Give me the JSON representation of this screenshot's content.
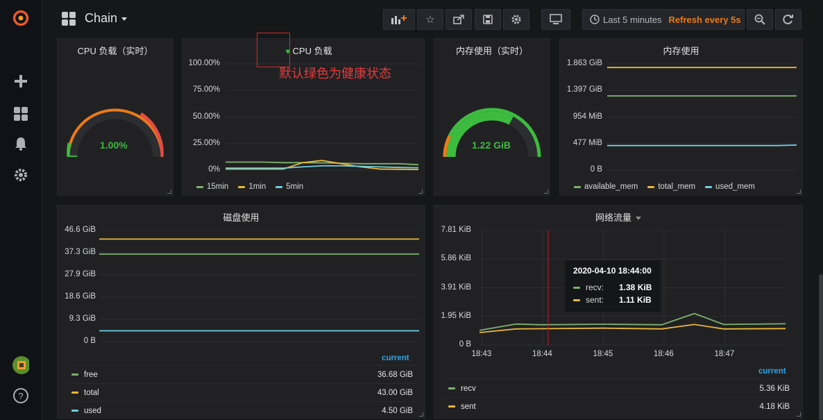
{
  "navbar": {
    "dashboard_title": "Chain",
    "time_range": "Last 5 minutes",
    "refresh": "Refresh every 5s"
  },
  "panels": {
    "cpu_gauge": {
      "title": "CPU 负载（实时）",
      "value": "1.00%",
      "value_number": 1.0,
      "max": 100
    },
    "cpu_graph": {
      "title": "CPU 负载",
      "health_icon": "heart-icon",
      "health_color": "#3dbb3f",
      "y_ticks": [
        "100.00%",
        "75.00%",
        "50.00%",
        "25.00%",
        "0%"
      ],
      "legend": [
        {
          "name": "15min",
          "color": "#7eb26d"
        },
        {
          "name": "1min",
          "color": "#eab839"
        },
        {
          "name": "5min",
          "color": "#6ed0e0"
        }
      ]
    },
    "mem_gauge": {
      "title": "内存使用（实时）",
      "value": "1.22 GiB",
      "value_number": 1.22,
      "max": 1.863
    },
    "mem_graph": {
      "title": "内存使用",
      "y_ticks": [
        "1.863 GiB",
        "1.397 GiB",
        "954 MiB",
        "477 MiB",
        "0 B"
      ],
      "legend": [
        {
          "name": "available_mem",
          "color": "#7eb26d"
        },
        {
          "name": "total_mem",
          "color": "#eab839"
        },
        {
          "name": "used_mem",
          "color": "#6ed0e0"
        }
      ]
    },
    "disk": {
      "title": "磁盘使用",
      "y_ticks": [
        "46.6 GiB",
        "37.3 GiB",
        "27.9 GiB",
        "18.6 GiB",
        "9.3 GiB",
        "0 B"
      ],
      "current_label": "current",
      "legend": [
        {
          "name": "free",
          "value": "36.68 GiB",
          "color": "#7eb26d"
        },
        {
          "name": "total",
          "value": "43.00 GiB",
          "color": "#eab839"
        },
        {
          "name": "used",
          "value": "4.50 GiB",
          "color": "#6ed0e0"
        }
      ]
    },
    "network": {
      "title": "网络流量",
      "y_ticks": [
        "7.81 KiB",
        "5.86 KiB",
        "3.91 KiB",
        "1.95 KiB",
        "0 B"
      ],
      "x_ticks": [
        "18:43",
        "18:44",
        "18:45",
        "18:46",
        "18:47"
      ],
      "current_label": "current",
      "legend": [
        {
          "name": "recv",
          "value": "5.36 KiB",
          "color": "#7eb26d"
        },
        {
          "name": "sent",
          "value": "4.18 KiB",
          "color": "#eab839"
        }
      ],
      "tooltip": {
        "time": "2020-04-10 18:44:00",
        "rows": [
          {
            "name": "recv:",
            "value": "1.38 KiB",
            "color": "#7eb26d"
          },
          {
            "name": "sent:",
            "value": "1.11 KiB",
            "color": "#eab839"
          }
        ]
      }
    }
  },
  "annotation": {
    "text": "默认绿色为健康状态",
    "color": "#e23c3c"
  },
  "chart_data": [
    {
      "type": "line",
      "title": "CPU 负载",
      "ylim": [
        0,
        100
      ],
      "x": [
        0,
        1,
        2,
        3,
        4,
        5,
        6,
        7,
        8,
        9,
        10
      ],
      "series": [
        {
          "name": "15min",
          "values": [
            7.5,
            7.5,
            7.5,
            7,
            7,
            6.8,
            6.5,
            6,
            6,
            6,
            5
          ]
        },
        {
          "name": "1min",
          "values": [
            1,
            1,
            1,
            1,
            7,
            9,
            6,
            3,
            1,
            0.8,
            0.5
          ]
        },
        {
          "name": "5min",
          "values": [
            1.8,
            1.8,
            1.8,
            1.8,
            3,
            4,
            4,
            3.5,
            3,
            2.5,
            2.2
          ]
        }
      ]
    },
    {
      "type": "line",
      "title": "内存使用",
      "ylim": [
        0,
        1.863
      ],
      "x": [
        0,
        1,
        2,
        3,
        4,
        5,
        6,
        7,
        8,
        9,
        10
      ],
      "series": [
        {
          "name": "available_mem",
          "values": [
            1.3,
            1.3,
            1.3,
            1.3,
            1.3,
            1.3,
            1.3,
            1.3,
            1.3,
            1.3,
            1.3
          ]
        },
        {
          "name": "total_mem",
          "values": [
            1.8,
            1.8,
            1.8,
            1.8,
            1.8,
            1.8,
            1.8,
            1.8,
            1.8,
            1.8,
            1.8
          ]
        },
        {
          "name": "used_mem",
          "values": [
            0.43,
            0.43,
            0.43,
            0.43,
            0.43,
            0.43,
            0.43,
            0.43,
            0.43,
            0.43,
            0.44
          ]
        }
      ]
    },
    {
      "type": "line",
      "title": "磁盘使用",
      "ylim": [
        0,
        46.6
      ],
      "x": [
        0,
        1,
        2,
        3,
        4,
        5,
        6,
        7,
        8,
        9,
        10
      ],
      "series": [
        {
          "name": "free",
          "values": [
            36.68,
            36.68,
            36.68,
            36.68,
            36.68,
            36.68,
            36.68,
            36.68,
            36.68,
            36.68,
            36.68
          ]
        },
        {
          "name": "total",
          "values": [
            43.0,
            43.0,
            43.0,
            43.0,
            43.0,
            43.0,
            43.0,
            43.0,
            43.0,
            43.0,
            43.0
          ]
        },
        {
          "name": "used",
          "values": [
            4.5,
            4.5,
            4.5,
            4.5,
            4.5,
            4.5,
            4.5,
            4.5,
            4.5,
            4.5,
            4.5
          ]
        }
      ]
    },
    {
      "type": "line",
      "title": "网络流量",
      "ylim": [
        0,
        7.81
      ],
      "xlim": [
        18.716,
        18.8
      ],
      "x": [
        18.716,
        18.726,
        18.733,
        18.75,
        18.766,
        18.775,
        18.783,
        18.8
      ],
      "x_hours": true,
      "series": [
        {
          "name": "recv",
          "values": [
            1.0,
            1.43,
            1.38,
            1.42,
            1.38,
            2.15,
            1.4,
            1.45
          ]
        },
        {
          "name": "sent",
          "values": [
            0.85,
            1.1,
            1.11,
            1.15,
            1.1,
            1.4,
            1.1,
            1.12
          ]
        }
      ]
    }
  ]
}
